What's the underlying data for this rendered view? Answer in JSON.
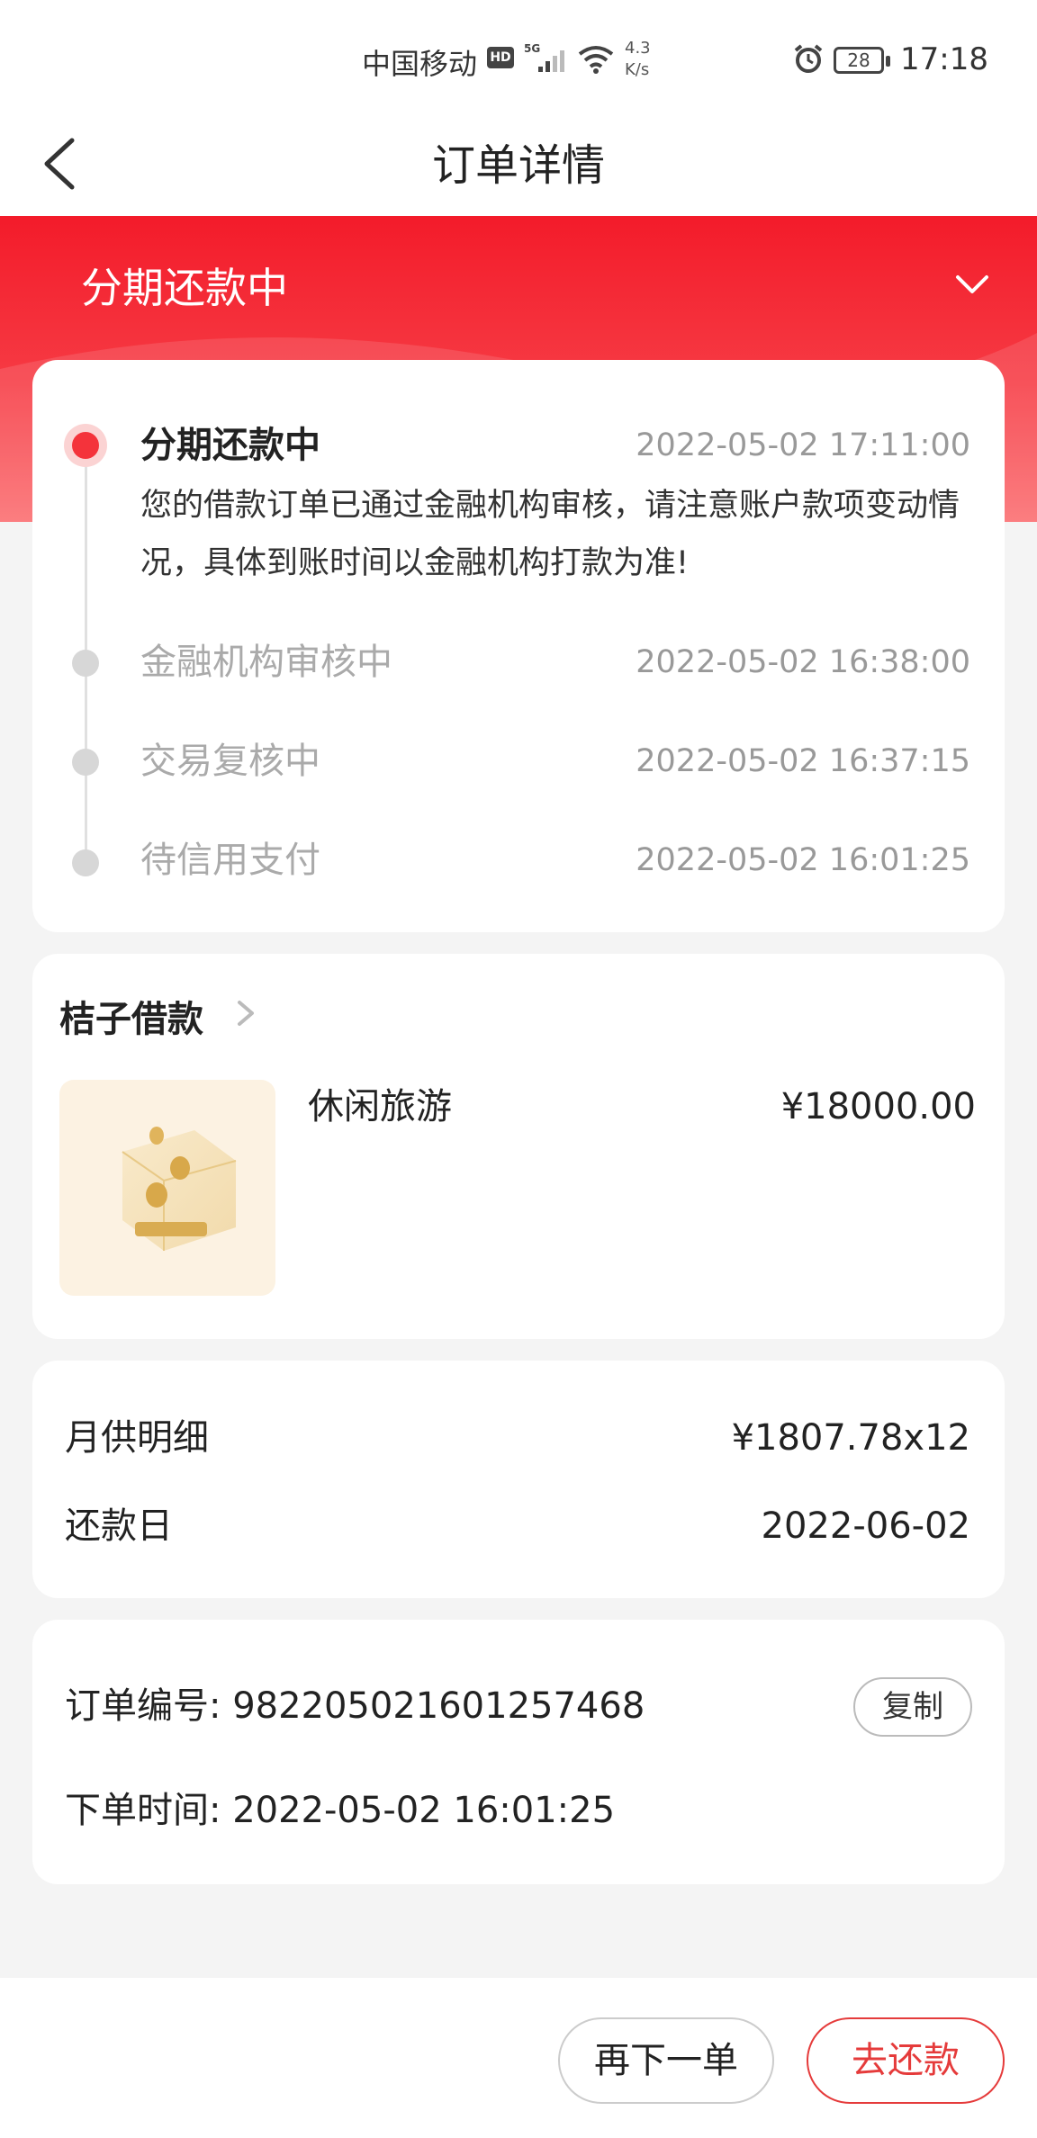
{
  "status_bar": {
    "carrier": "中国移动",
    "hd_badge": "HD",
    "network": "5G",
    "net_speed_value": "4.3",
    "net_speed_unit": "K/s",
    "battery": "28",
    "time": "17:18"
  },
  "nav": {
    "title": "订单详情"
  },
  "hero": {
    "status_title": "分期还款中"
  },
  "timeline": {
    "steps": [
      {
        "title": "分期还款中",
        "time": "2022-05-02 17:11:00",
        "description": "您的借款订单已通过金融机构审核，请注意账户款项变动情况，具体到账时间以金融机构打款为准!"
      },
      {
        "title": "金融机构审核中",
        "time": "2022-05-02 16:38:00"
      },
      {
        "title": "交易复核中",
        "time": "2022-05-02 16:37:15"
      },
      {
        "title": "待信用支付",
        "time": "2022-05-02 16:01:25"
      }
    ]
  },
  "product": {
    "provider": "桔子借款",
    "name": "休闲旅游",
    "price": "¥18000.00"
  },
  "repayment": {
    "monthly_label": "月供明细",
    "monthly_value": "¥1807.78x12",
    "due_label": "还款日",
    "due_value": "2022-06-02"
  },
  "order": {
    "number_text": "订单编号:  982205021601257468",
    "copy_label": "复制",
    "time_text": "下单时间:  2022-05-02 16:01:25"
  },
  "actions": {
    "reorder_label": "再下一单",
    "repay_label": "去还款"
  },
  "colors": {
    "accent": "#f4333b",
    "hero_gradient_top": "#f31b2a",
    "background": "#f4f4f4"
  }
}
